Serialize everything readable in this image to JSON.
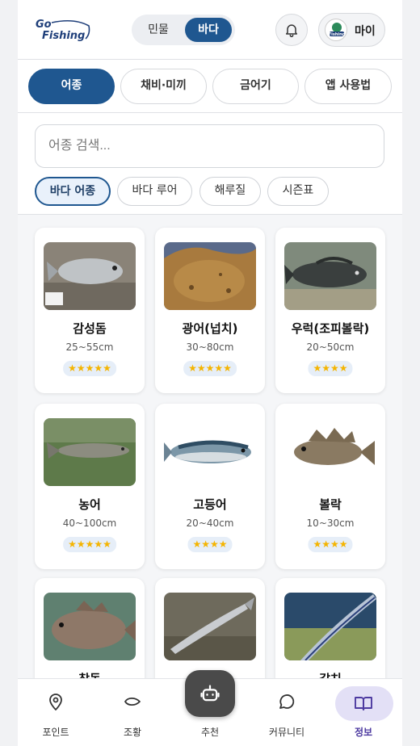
{
  "header": {
    "logo_text_1": "Go",
    "logo_text_2": "Fishing",
    "water_toggle": {
      "fresh_label": "민물",
      "sea_label": "바다",
      "selected": "바다"
    },
    "bell_icon": "bell-icon",
    "my_label": "마이",
    "avatar_text": "Fishing"
  },
  "category_tabs": [
    {
      "label": "어종",
      "active": true
    },
    {
      "label": "채비·미끼",
      "active": false
    },
    {
      "label": "금어기",
      "active": false
    },
    {
      "label": "앱 사용법",
      "active": false
    }
  ],
  "search": {
    "placeholder": "어종 검색...",
    "value": ""
  },
  "filters": [
    {
      "label": "바다 어종",
      "active": true
    },
    {
      "label": "바다 루어",
      "active": false
    },
    {
      "label": "해루질",
      "active": false
    },
    {
      "label": "시즌표",
      "active": false
    }
  ],
  "fish": [
    {
      "name": "감성돔",
      "size": "25~55cm",
      "stars": "★★★★★",
      "rating": 5
    },
    {
      "name": "광어(넙치)",
      "size": "30~80cm",
      "stars": "★★★★★",
      "rating": 5
    },
    {
      "name": "우럭(조피볼락)",
      "size": "20~50cm",
      "stars": "★★★★",
      "rating": 4
    },
    {
      "name": "농어",
      "size": "40~100cm",
      "stars": "★★★★★",
      "rating": 5
    },
    {
      "name": "고등어",
      "size": "20~40cm",
      "stars": "★★★★",
      "rating": 4
    },
    {
      "name": "볼락",
      "size": "10~30cm",
      "stars": "★★★★",
      "rating": 4
    },
    {
      "name": "참돔",
      "size": "",
      "stars": "",
      "rating": null
    },
    {
      "name": "",
      "size": "",
      "stars": "",
      "rating": null
    },
    {
      "name": "갈치",
      "size": "",
      "stars": "",
      "rating": null
    }
  ],
  "bottom_nav": [
    {
      "label": "포인트",
      "icon": "map-pin-icon",
      "active": false
    },
    {
      "label": "조황",
      "icon": "fish-icon",
      "active": false
    },
    {
      "label": "추천",
      "icon": "robot-icon",
      "active": false
    },
    {
      "label": "커뮤니티",
      "icon": "chat-bubble-icon",
      "active": false
    },
    {
      "label": "정보",
      "icon": "book-icon",
      "active": true
    }
  ],
  "colors": {
    "primary": "#1f5790",
    "active_nav": "#4d3aa0",
    "star": "#f4b400"
  }
}
